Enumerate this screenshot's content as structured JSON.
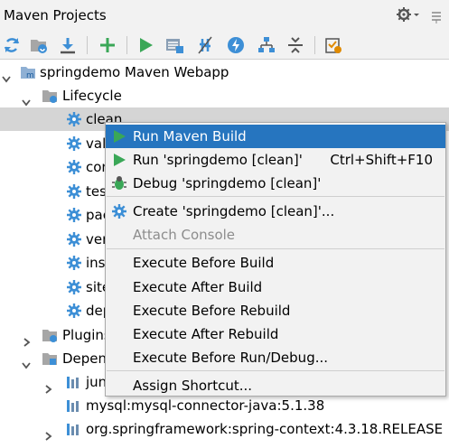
{
  "header": {
    "title": "Maven Projects"
  },
  "toolbar": {
    "icons": [
      "reimport-icon",
      "generate-sources-icon",
      "download-icon",
      "add-icon",
      "run-icon",
      "execute-goal-icon",
      "toggle-offline-icon",
      "skip-tests-icon",
      "show-dependencies-icon",
      "collapse-all-icon",
      "settings-icon"
    ]
  },
  "tree": {
    "project": "springdemo Maven Webapp",
    "lifecycle": "Lifecycle",
    "goals": [
      "clean",
      "vali",
      "con",
      "tes",
      "pac",
      "ver",
      "inst",
      "site",
      "dep"
    ],
    "plugins": "Plugins",
    "dependencies": "Depen",
    "deps": [
      "jun",
      "mysql:mysql-connector-java:5.1.38",
      "org.springframework:spring-context:4.3.18.RELEASE"
    ]
  },
  "menu": {
    "run_maven_build": "Run Maven Build",
    "run": "Run 'springdemo [clean]'",
    "run_shortcut": "Ctrl+Shift+F10",
    "debug": "Debug 'springdemo [clean]'",
    "create": "Create 'springdemo [clean]'...",
    "attach_console": "Attach Console",
    "exec_before_build": "Execute Before Build",
    "exec_after_build": "Execute After Build",
    "exec_before_rebuild": "Execute Before Rebuild",
    "exec_after_rebuild": "Execute After Rebuild",
    "exec_before_run": "Execute Before Run/Debug...",
    "assign_shortcut": "Assign Shortcut..."
  },
  "colors": {
    "highlight": "#2675bf",
    "run_green": "#3aa757",
    "maven_blue": "#3d8fd6"
  }
}
